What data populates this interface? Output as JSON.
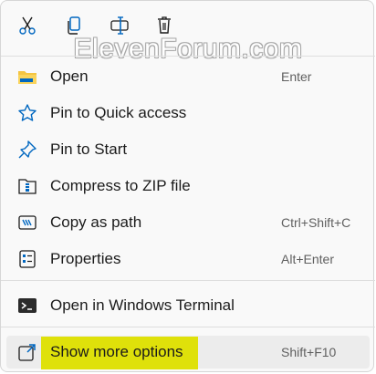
{
  "watermark": "ElevenForum.com",
  "toolbar": {
    "cut_icon": "scissors-icon",
    "copy_icon": "copy-icon",
    "rename_icon": "rename-icon",
    "delete_icon": "trash-icon"
  },
  "items": [
    {
      "label": "Open",
      "shortcut": "Enter",
      "icon": "folder-icon"
    },
    {
      "label": "Pin to Quick access",
      "shortcut": "",
      "icon": "star-icon"
    },
    {
      "label": "Pin to Start",
      "shortcut": "",
      "icon": "pin-icon"
    },
    {
      "label": "Compress to ZIP file",
      "shortcut": "",
      "icon": "zip-icon"
    },
    {
      "label": "Copy as path",
      "shortcut": "Ctrl+Shift+C",
      "icon": "copy-path-icon"
    },
    {
      "label": "Properties",
      "shortcut": "Alt+Enter",
      "icon": "properties-icon"
    },
    {
      "label": "Open in Windows Terminal",
      "shortcut": "",
      "icon": "terminal-icon"
    },
    {
      "label": "Show more options",
      "shortcut": "Shift+F10",
      "icon": "more-options-icon"
    }
  ],
  "colors": {
    "accent": "#0067c0",
    "highlight": "#dfe10a",
    "folder": "#f4c542"
  }
}
